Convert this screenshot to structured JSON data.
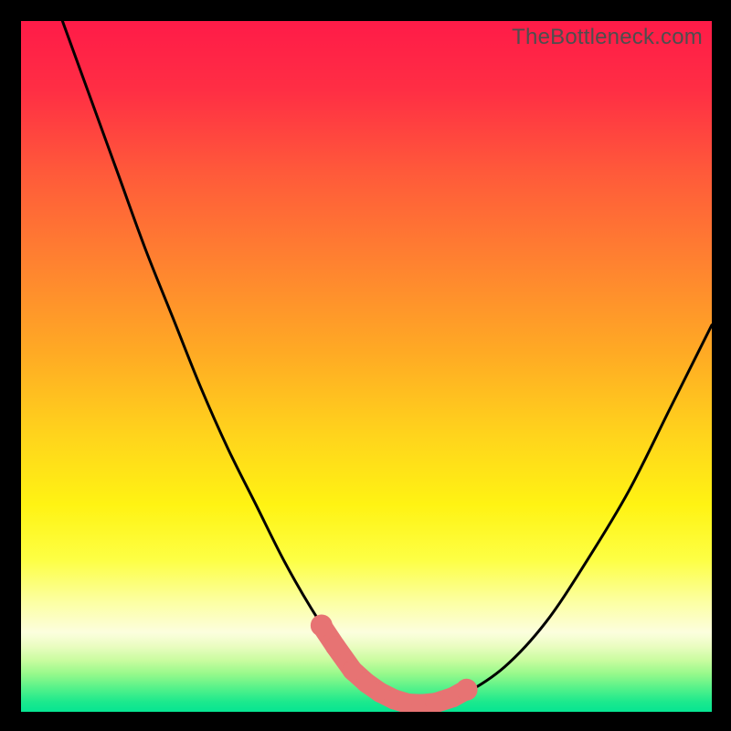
{
  "watermark": "TheBottleneck.com",
  "colors": {
    "black": "#000000",
    "curve": "#000000",
    "marker": "#e77373",
    "watermark": "#4e4e4e"
  },
  "gradient_stops": [
    {
      "offset": 0.0,
      "color": "#ff1b48"
    },
    {
      "offset": 0.1,
      "color": "#ff2e44"
    },
    {
      "offset": 0.22,
      "color": "#ff5a3a"
    },
    {
      "offset": 0.35,
      "color": "#ff8230"
    },
    {
      "offset": 0.48,
      "color": "#ffaa24"
    },
    {
      "offset": 0.6,
      "color": "#ffd41c"
    },
    {
      "offset": 0.7,
      "color": "#fff313"
    },
    {
      "offset": 0.78,
      "color": "#fdff44"
    },
    {
      "offset": 0.84,
      "color": "#fcffa1"
    },
    {
      "offset": 0.885,
      "color": "#fcfede"
    },
    {
      "offset": 0.905,
      "color": "#eafdc1"
    },
    {
      "offset": 0.925,
      "color": "#cafca0"
    },
    {
      "offset": 0.945,
      "color": "#97f98b"
    },
    {
      "offset": 0.965,
      "color": "#58f28a"
    },
    {
      "offset": 0.985,
      "color": "#1de98d"
    },
    {
      "offset": 1.0,
      "color": "#06e592"
    }
  ],
  "chart_data": {
    "type": "line",
    "title": "",
    "xlabel": "",
    "ylabel": "",
    "xlim": [
      0,
      100
    ],
    "ylim": [
      0,
      100
    ],
    "series": [
      {
        "name": "bottleneck-curve",
        "x": [
          6,
          10,
          14,
          18,
          22,
          26,
          30,
          34,
          38,
          42,
          46,
          48,
          50,
          52,
          54,
          56,
          58,
          60,
          64,
          70,
          76,
          82,
          88,
          94,
          100
        ],
        "y": [
          100,
          89,
          78,
          67,
          57,
          47,
          38,
          30,
          22,
          15,
          9,
          6.5,
          4.5,
          3,
          2,
          1.3,
          1,
          1.2,
          2.5,
          6.5,
          13,
          22,
          32,
          44,
          56
        ]
      }
    ],
    "markers": {
      "name": "highlight-band",
      "x": [
        43.5,
        45.5,
        48,
        50,
        52,
        54,
        56,
        58,
        60,
        62.5,
        64.5
      ],
      "y": [
        12.5,
        9.5,
        6,
        4.2,
        2.8,
        1.8,
        1.2,
        1.1,
        1.3,
        2.1,
        3.2
      ]
    }
  }
}
